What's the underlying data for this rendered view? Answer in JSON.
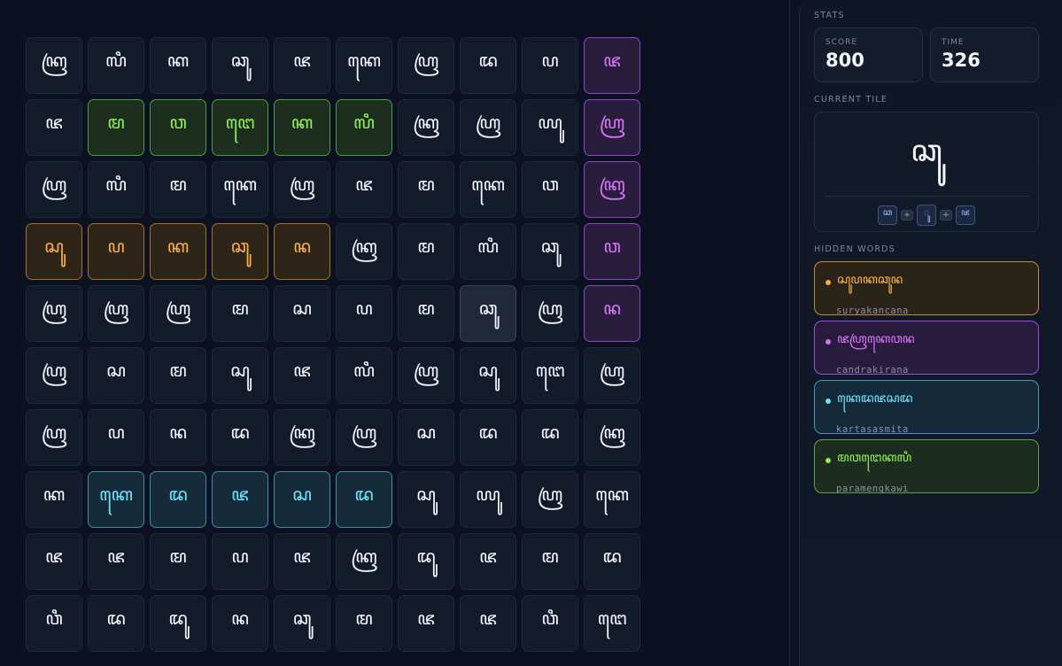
{
  "grid": [
    [
      "ꦏꦿ",
      "ꦭꦶ",
      "ꦏ",
      "ꦕꦸ",
      "ꦗ",
      "ꦏꦺ",
      "ꦲꦿ",
      "ꦢ",
      "ꦥ",
      "ꦗ"
    ],
    [
      "ꦗ",
      "ꦩ",
      "ꦮ",
      "ꦔꦺ",
      "ꦏ",
      "ꦭꦶ",
      "ꦏꦿ",
      "ꦲꦿ",
      "ꦪꦸ",
      "ꦲꦿ"
    ],
    [
      "ꦲꦿ",
      "ꦭꦶ",
      "ꦩ",
      "ꦏꦺ",
      "ꦲꦿ",
      "ꦗ",
      "ꦩ",
      "ꦏꦺ",
      "ꦮ",
      "ꦏꦿ"
    ],
    [
      "ꦱꦸ",
      "ꦥ",
      "ꦏ",
      "ꦕꦸ",
      "ꦤ",
      "ꦏꦿ",
      "ꦩ",
      "ꦭꦶ",
      "ꦕꦸ",
      "ꦮ"
    ],
    [
      "ꦲꦿ",
      "ꦲꦿ",
      "ꦲꦿ",
      "ꦩ",
      "ꦱ",
      "ꦥ",
      "ꦩ",
      "ꦕꦸ",
      "ꦲꦿ",
      "ꦤ"
    ],
    [
      "ꦲꦿ",
      "ꦱ",
      "ꦩ",
      "ꦱꦸ",
      "ꦗ",
      "ꦭꦶ",
      "ꦲꦿ",
      "ꦱꦸ",
      "ꦔꦺ",
      "ꦲꦿ"
    ],
    [
      "ꦲꦿ",
      "ꦥ",
      "ꦤ",
      "ꦢ",
      "ꦏꦿ",
      "ꦲꦿ",
      "ꦱ",
      "ꦢ",
      "ꦢ",
      "ꦏꦿ"
    ],
    [
      "ꦏ",
      "ꦏꦺ",
      "ꦢ",
      "ꦗ",
      "ꦱ",
      "ꦢ",
      "ꦱꦸ",
      "ꦪꦸ",
      "ꦲꦿ",
      "ꦏꦺ"
    ],
    [
      "ꦗ",
      "ꦗ",
      "ꦩ",
      "ꦥ",
      "ꦗ",
      "ꦏꦿ",
      "ꦢꦸ",
      "ꦗ",
      "ꦩ",
      "ꦢ"
    ],
    [
      "ꦮꦶ",
      "ꦢ",
      "ꦢꦸ",
      "ꦤ",
      "ꦕꦸ",
      "ꦩ",
      "ꦗ",
      "ꦗ",
      "ꦮꦶ",
      "ꦔꦺ"
    ]
  ],
  "highlights": {
    "orange": [
      [
        3,
        0
      ],
      [
        3,
        1
      ],
      [
        3,
        2
      ],
      [
        3,
        3
      ],
      [
        3,
        4
      ]
    ],
    "purple": [
      [
        0,
        9
      ],
      [
        1,
        9
      ],
      [
        2,
        9
      ],
      [
        3,
        9
      ],
      [
        4,
        9
      ]
    ],
    "cyan": [
      [
        7,
        1
      ],
      [
        7,
        2
      ],
      [
        7,
        3
      ],
      [
        7,
        4
      ],
      [
        7,
        5
      ]
    ],
    "green": [
      [
        1,
        1
      ],
      [
        1,
        2
      ],
      [
        1,
        3
      ],
      [
        1,
        4
      ],
      [
        1,
        5
      ]
    ],
    "hover": [
      [
        4,
        7
      ]
    ]
  },
  "sidebar": {
    "stats_title": "STATS",
    "score_label": "SCORE",
    "score_value": "800",
    "time_label": "TIME",
    "time_value": "326",
    "current_title": "CURRENT TILE",
    "current_glyph": "ꦕꦸ",
    "current_parts": [
      "ꦕ",
      "+",
      "ꦸ",
      "+",
      "ꦗ"
    ],
    "hidden_title": "HIDDEN WORDS",
    "words": [
      {
        "script": "ꦱꦸꦥꦏꦕꦸꦤ",
        "latin": "suryakancana"
      },
      {
        "script": "ꦗꦲꦿꦏꦺꦮꦤ",
        "latin": "candrakirana"
      },
      {
        "script": "ꦏꦺꦢꦗꦱꦢ",
        "latin": "kartasasmita"
      },
      {
        "script": "ꦩꦮꦔꦺꦏꦭꦶ",
        "latin": "paramengkawi"
      }
    ]
  }
}
